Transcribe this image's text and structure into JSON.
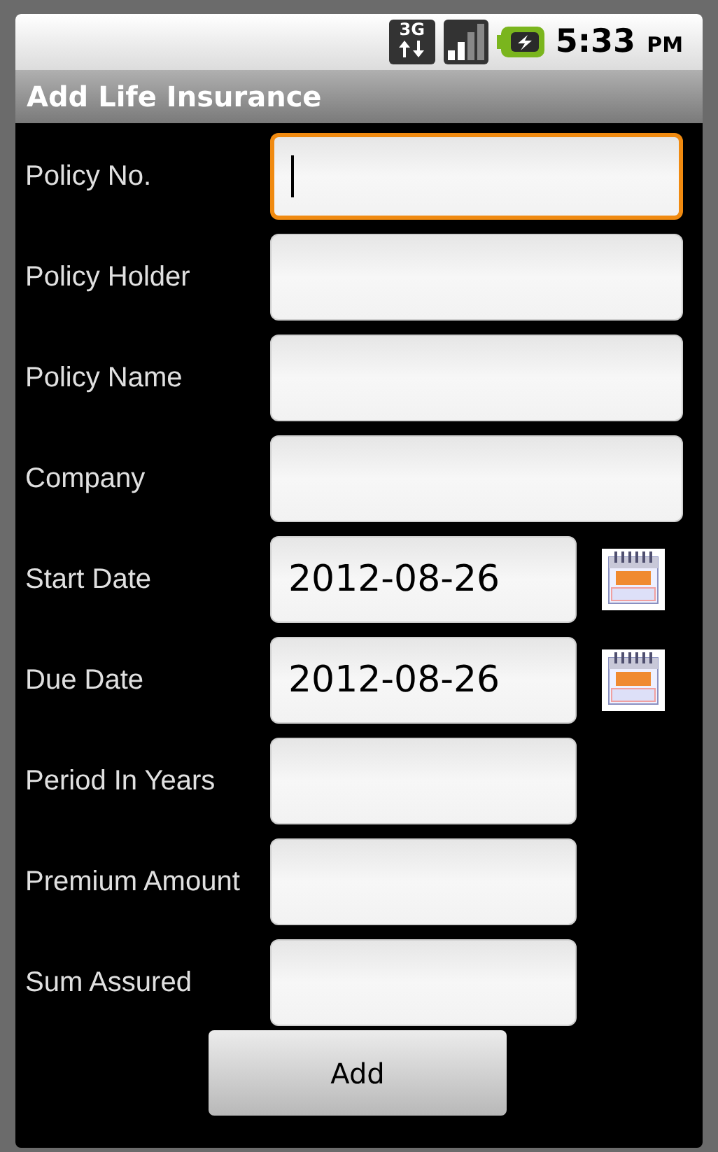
{
  "status_bar": {
    "network": "3G",
    "time": "5:33",
    "ampm": "PM"
  },
  "title_bar": {
    "title": "Add Life Insurance"
  },
  "form": {
    "fields": [
      {
        "label": "Policy No.",
        "kind": "text",
        "focused": true
      },
      {
        "label": "Policy Holder",
        "kind": "text",
        "focused": false
      },
      {
        "label": "Policy Name",
        "kind": "text",
        "focused": false
      },
      {
        "label": "Company",
        "kind": "text",
        "focused": false
      },
      {
        "label": "Start Date",
        "kind": "date",
        "value": "2012-08-26",
        "focused": false
      },
      {
        "label": "Due Date",
        "kind": "date",
        "value": "2012-08-26",
        "focused": false
      },
      {
        "label": "Period In Years",
        "kind": "number",
        "focused": false
      },
      {
        "label": "Premium Amount",
        "kind": "number",
        "focused": false
      },
      {
        "label": "Sum Assured",
        "kind": "number",
        "focused": false
      }
    ]
  },
  "buttons": [
    {
      "label": "Add"
    }
  ]
}
